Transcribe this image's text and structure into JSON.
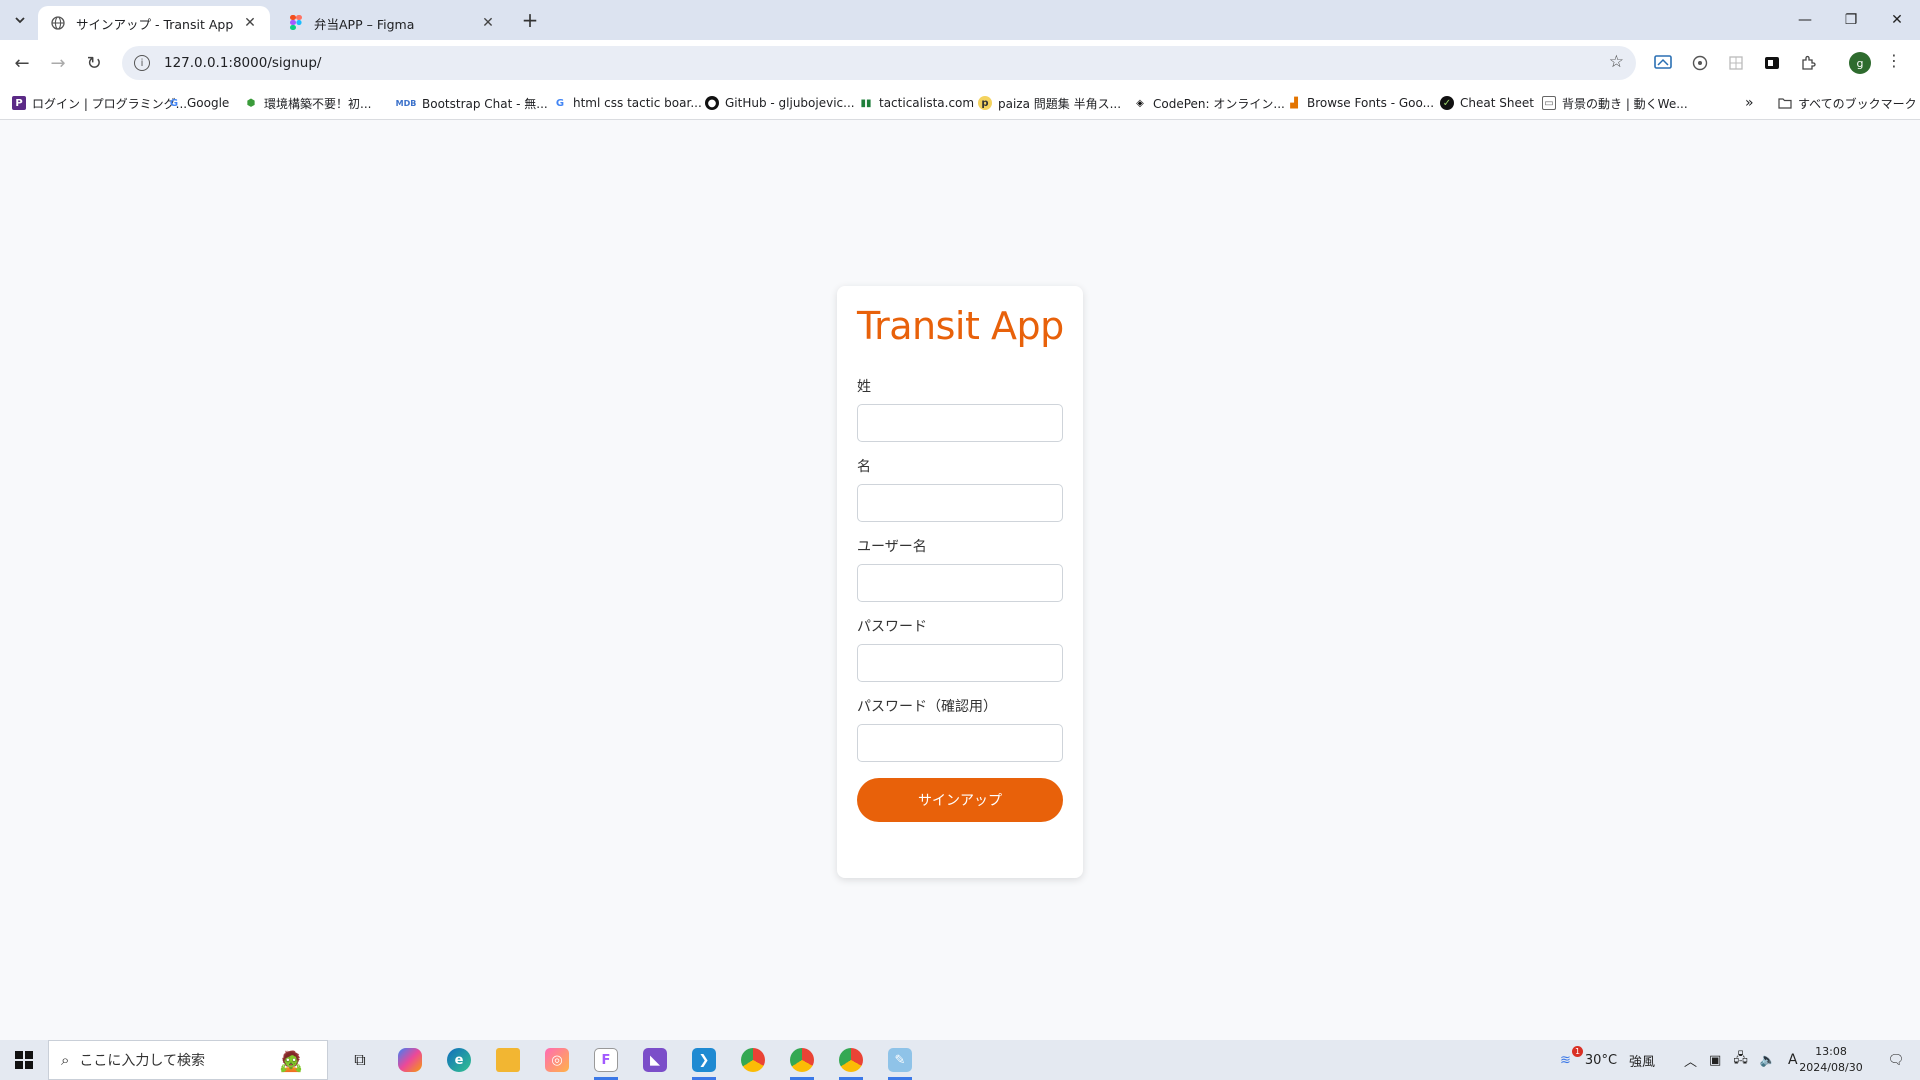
{
  "browser": {
    "tabs": [
      {
        "title": "サインアップ - Transit App",
        "active": true,
        "favicon": "globe-icon"
      },
      {
        "title": "弁当APP – Figma",
        "active": false,
        "favicon": "figma-icon"
      }
    ],
    "url": "127.0.0.1:8000/signup/",
    "bookmarks": [
      {
        "label": "ログイン | プログラミング...",
        "icon": "p-icon"
      },
      {
        "label": "Google",
        "icon": "google-icon"
      },
      {
        "label": "環境構築不要！初...",
        "icon": "leaf-icon"
      },
      {
        "label": "Bootstrap Chat - 無...",
        "icon": "mdb-icon"
      },
      {
        "label": "html css tactic boar...",
        "icon": "google-icon"
      },
      {
        "label": "GitHub - gljubojevic...",
        "icon": "github-icon"
      },
      {
        "label": "tacticalista.com",
        "icon": "bars-icon"
      },
      {
        "label": "paiza 問題集 半角ス...",
        "icon": "paiza-icon"
      },
      {
        "label": "CodePen: オンライン...",
        "icon": "codepen-icon"
      },
      {
        "label": "Browse Fonts - Goo...",
        "icon": "fonts-icon"
      },
      {
        "label": "Cheat Sheet",
        "icon": "cheatsheet-icon"
      },
      {
        "label": "背景の動き | 動くWe...",
        "icon": "card-icon"
      }
    ],
    "all_bookmarks_label": "すべてのブックマーク",
    "profile_initial": "g"
  },
  "signup": {
    "app_title": "Transit App",
    "fields": [
      {
        "label": "姓",
        "value": ""
      },
      {
        "label": "名",
        "value": ""
      },
      {
        "label": "ユーザー名",
        "value": ""
      },
      {
        "label": "パスワード",
        "value": ""
      },
      {
        "label": "パスワード（確認用）",
        "value": ""
      }
    ],
    "submit_label": "サインアップ",
    "accent_color": "#e8610a"
  },
  "taskbar": {
    "search_placeholder": "ここに入力して検索",
    "weather": "30°C",
    "wind": "強風",
    "ime": "A",
    "time": "13:08",
    "date": "2024/08/30",
    "notification_badge": "1"
  }
}
